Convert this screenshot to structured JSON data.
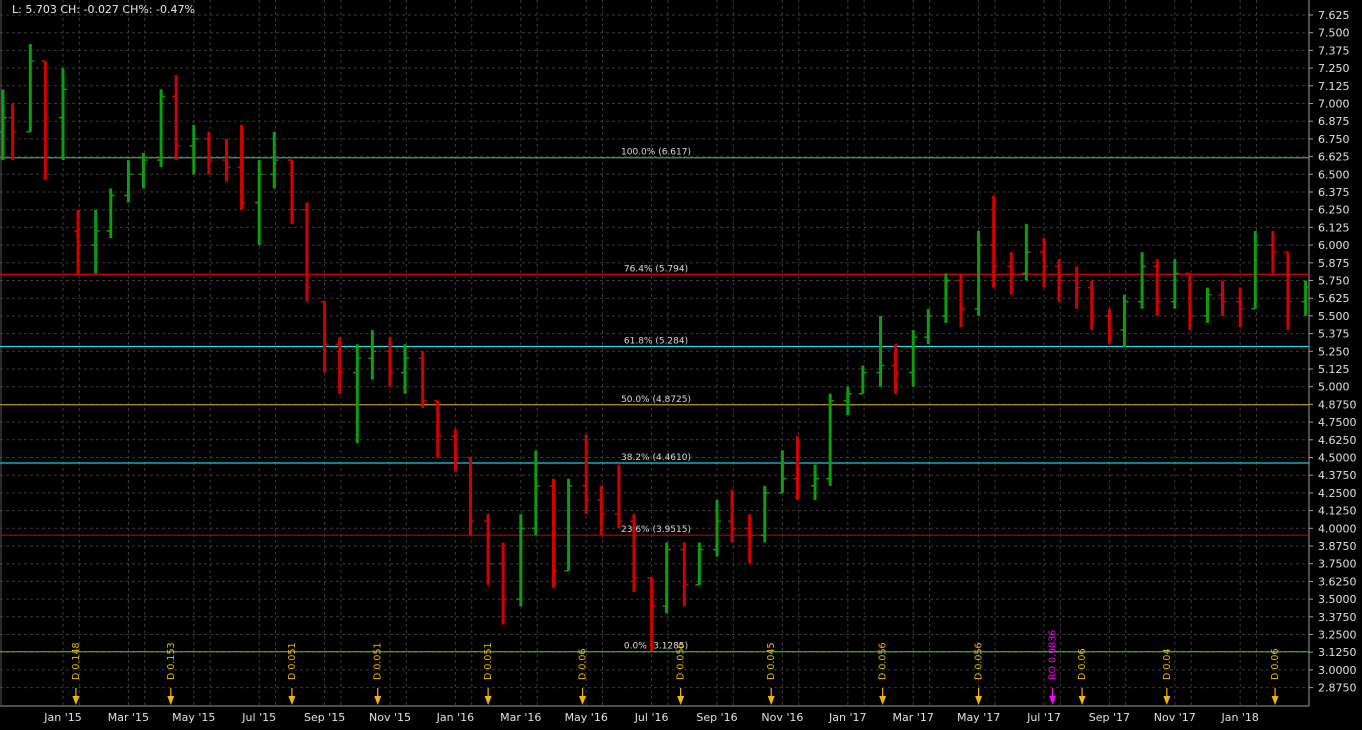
{
  "header": {
    "readout": "L: 5.703 CH: -0.027 CH%: -0.47%"
  },
  "colors": {
    "up": "#0c9e0c",
    "down": "#d40000",
    "background": "#000000",
    "grid": "#3a3a3a",
    "axis": "#9a9a9a",
    "dividend": "#f0b800",
    "rights": "#ff00ff"
  },
  "chart_data": {
    "type": "ohlc",
    "ylim": [
      2.8,
      7.68
    ],
    "y_ticks": [
      "7.625",
      "7.500",
      "7.375",
      "7.250",
      "7.125",
      "7.000",
      "6.875",
      "6.750",
      "6.625",
      "6.500",
      "6.375",
      "6.250",
      "6.125",
      "6.000",
      "5.875",
      "5.750",
      "5.625",
      "5.500",
      "5.375",
      "5.250",
      "5.125",
      "5.000",
      "4.8750",
      "4.7500",
      "4.6250",
      "4.5000",
      "4.3750",
      "4.2500",
      "4.1250",
      "4.0000",
      "3.8750",
      "3.7500",
      "3.6250",
      "3.5000",
      "3.3750",
      "3.2500",
      "3.1250",
      "3.0000",
      "2.8750"
    ],
    "x_ticks": [
      {
        "label": "Jan '15",
        "date": "2015-01-01"
      },
      {
        "label": "Mar '15",
        "date": "2015-03-01"
      },
      {
        "label": "May '15",
        "date": "2015-05-01"
      },
      {
        "label": "Jul '15",
        "date": "2015-07-01"
      },
      {
        "label": "Sep '15",
        "date": "2015-09-01"
      },
      {
        "label": "Nov '15",
        "date": "2015-11-01"
      },
      {
        "label": "Jan '16",
        "date": "2016-01-01"
      },
      {
        "label": "Mar '16",
        "date": "2016-03-01"
      },
      {
        "label": "May '16",
        "date": "2016-05-01"
      },
      {
        "label": "Jul '16",
        "date": "2016-07-01"
      },
      {
        "label": "Sep '16",
        "date": "2016-09-01"
      },
      {
        "label": "Nov '16",
        "date": "2016-11-01"
      },
      {
        "label": "Jan '17",
        "date": "2017-01-01"
      },
      {
        "label": "Mar '17",
        "date": "2017-03-01"
      },
      {
        "label": "May '17",
        "date": "2017-05-01"
      },
      {
        "label": "Jul '17",
        "date": "2017-07-01"
      },
      {
        "label": "Sep '17",
        "date": "2017-09-01"
      },
      {
        "label": "Nov '17",
        "date": "2017-11-01"
      },
      {
        "label": "Jan '18",
        "date": "2018-01-01"
      }
    ],
    "grid": true,
    "bars": [
      [
        "2014-11-05",
        6.8,
        7.1,
        6.6,
        6.9
      ],
      [
        "2014-11-15",
        6.9,
        7.0,
        6.6,
        6.8
      ],
      [
        "2014-12-01",
        6.8,
        7.42,
        6.8,
        7.3
      ],
      [
        "2014-12-15",
        7.3,
        7.3,
        6.46,
        6.9
      ],
      [
        "2015-01-01",
        6.9,
        7.25,
        6.6,
        7.1
      ],
      [
        "2015-01-15",
        6.1,
        6.25,
        5.79,
        6.0
      ],
      [
        "2015-02-01",
        6.0,
        6.25,
        5.8,
        6.1
      ],
      [
        "2015-02-15",
        6.1,
        6.4,
        6.05,
        6.35
      ],
      [
        "2015-03-01",
        6.35,
        6.6,
        6.3,
        6.5
      ],
      [
        "2015-03-15",
        6.5,
        6.65,
        6.4,
        6.6
      ],
      [
        "2015-04-01",
        6.6,
        7.1,
        6.55,
        7.05
      ],
      [
        "2015-04-15",
        7.05,
        7.2,
        6.6,
        6.7
      ],
      [
        "2015-05-01",
        6.7,
        6.85,
        6.5,
        6.75
      ],
      [
        "2015-05-15",
        6.75,
        6.8,
        6.5,
        6.6
      ],
      [
        "2015-06-01",
        6.6,
        6.75,
        6.45,
        6.55
      ],
      [
        "2015-06-15",
        6.55,
        6.85,
        6.25,
        6.3
      ],
      [
        "2015-07-01",
        6.3,
        6.6,
        6.0,
        6.5
      ],
      [
        "2015-07-15",
        6.5,
        6.8,
        6.4,
        6.6
      ],
      [
        "2015-08-01",
        6.6,
        6.6,
        6.15,
        6.25
      ],
      [
        "2015-08-15",
        6.25,
        6.3,
        5.6,
        5.7
      ],
      [
        "2015-09-01",
        5.6,
        5.6,
        5.1,
        5.3
      ],
      [
        "2015-09-15",
        5.3,
        5.35,
        4.95,
        5.1
      ],
      [
        "2015-10-01",
        5.1,
        5.3,
        4.6,
        5.2
      ],
      [
        "2015-10-15",
        5.2,
        5.4,
        5.05,
        5.25
      ],
      [
        "2015-11-01",
        5.25,
        5.35,
        5.0,
        5.1
      ],
      [
        "2015-11-15",
        5.1,
        5.3,
        4.95,
        5.2
      ],
      [
        "2015-12-01",
        5.2,
        5.25,
        4.85,
        4.9
      ],
      [
        "2015-12-15",
        4.9,
        4.9,
        4.5,
        4.65
      ],
      [
        "2016-01-01",
        4.65,
        4.7,
        4.4,
        4.5
      ],
      [
        "2016-01-15",
        4.5,
        4.5,
        3.95,
        4.05
      ],
      [
        "2016-02-01",
        4.05,
        4.1,
        3.6,
        3.75
      ],
      [
        "2016-02-15",
        3.75,
        3.9,
        3.32,
        3.5
      ],
      [
        "2016-03-01",
        3.5,
        4.1,
        3.45,
        4.0
      ],
      [
        "2016-03-15",
        4.0,
        4.55,
        3.95,
        4.3
      ],
      [
        "2016-04-01",
        4.3,
        4.35,
        3.58,
        3.7
      ],
      [
        "2016-04-15",
        3.7,
        4.35,
        3.7,
        4.3
      ],
      [
        "2016-05-01",
        4.3,
        4.66,
        4.1,
        4.2
      ],
      [
        "2016-05-15",
        4.2,
        4.3,
        3.95,
        4.1
      ],
      [
        "2016-06-01",
        4.1,
        4.45,
        4.0,
        4.05
      ],
      [
        "2016-06-15",
        4.05,
        4.1,
        3.55,
        3.65
      ],
      [
        "2016-07-01",
        3.65,
        3.65,
        3.13,
        3.45
      ],
      [
        "2016-07-15",
        3.45,
        3.9,
        3.4,
        3.85
      ],
      [
        "2016-08-01",
        3.85,
        3.9,
        3.45,
        3.6
      ],
      [
        "2016-08-15",
        3.6,
        3.9,
        3.6,
        3.85
      ],
      [
        "2016-09-01",
        3.85,
        4.2,
        3.8,
        4.05
      ],
      [
        "2016-09-15",
        4.05,
        4.27,
        3.9,
        4.0
      ],
      [
        "2016-10-01",
        4.0,
        4.1,
        3.75,
        3.95
      ],
      [
        "2016-10-15",
        3.95,
        4.3,
        3.9,
        4.25
      ],
      [
        "2016-11-01",
        4.25,
        4.55,
        4.25,
        4.35
      ],
      [
        "2016-11-15",
        4.35,
        4.65,
        4.2,
        4.3
      ],
      [
        "2016-12-01",
        4.3,
        4.45,
        4.2,
        4.35
      ],
      [
        "2016-12-15",
        4.35,
        4.95,
        4.3,
        4.9
      ],
      [
        "2017-01-01",
        4.9,
        5.0,
        4.8,
        4.95
      ],
      [
        "2017-01-15",
        4.95,
        5.15,
        4.95,
        5.1
      ],
      [
        "2017-02-01",
        5.1,
        5.5,
        5.0,
        5.15
      ],
      [
        "2017-02-15",
        5.15,
        5.3,
        4.95,
        5.1
      ],
      [
        "2017-03-01",
        5.1,
        5.4,
        5.0,
        5.35
      ],
      [
        "2017-03-15",
        5.35,
        5.55,
        5.3,
        5.5
      ],
      [
        "2017-04-01",
        5.5,
        5.8,
        5.45,
        5.75
      ],
      [
        "2017-04-15",
        5.75,
        5.8,
        5.42,
        5.55
      ],
      [
        "2017-05-01",
        5.55,
        6.1,
        5.5,
        6.0
      ],
      [
        "2017-05-15",
        6.0,
        6.35,
        5.7,
        5.85
      ],
      [
        "2017-06-01",
        5.85,
        5.95,
        5.65,
        5.8
      ],
      [
        "2017-06-15",
        5.8,
        6.15,
        5.75,
        5.95
      ],
      [
        "2017-07-01",
        5.95,
        6.05,
        5.7,
        5.85
      ],
      [
        "2017-07-15",
        5.85,
        5.9,
        5.6,
        5.75
      ],
      [
        "2017-08-01",
        5.75,
        5.85,
        5.55,
        5.7
      ],
      [
        "2017-08-15",
        5.7,
        5.75,
        5.4,
        5.5
      ],
      [
        "2017-09-01",
        5.5,
        5.55,
        5.3,
        5.4
      ],
      [
        "2017-09-15",
        5.4,
        5.65,
        5.28,
        5.6
      ],
      [
        "2017-10-01",
        5.6,
        5.95,
        5.55,
        5.85
      ],
      [
        "2017-10-15",
        5.85,
        5.9,
        5.5,
        5.6
      ],
      [
        "2017-11-01",
        5.6,
        5.9,
        5.55,
        5.8
      ],
      [
        "2017-11-15",
        5.8,
        5.8,
        5.4,
        5.5
      ],
      [
        "2017-12-01",
        5.5,
        5.7,
        5.45,
        5.65
      ],
      [
        "2017-12-15",
        5.65,
        5.75,
        5.5,
        5.6
      ],
      [
        "2018-01-01",
        5.6,
        5.7,
        5.42,
        5.55
      ],
      [
        "2018-01-15",
        5.55,
        6.1,
        5.55,
        6.0
      ],
      [
        "2018-02-01",
        6.0,
        6.1,
        5.8,
        5.95
      ],
      [
        "2018-02-15",
        5.95,
        5.95,
        5.4,
        5.6
      ],
      [
        "2018-03-01",
        5.6,
        5.75,
        5.5,
        5.703
      ]
    ],
    "fib_levels": [
      {
        "label": "100.0% (6.617)",
        "value": 6.617,
        "color": "#5f8f5f"
      },
      {
        "label": "76.4% (5.794)",
        "value": 5.794,
        "color": "#e00000"
      },
      {
        "label": "61.8% (5.284)",
        "value": 5.284,
        "color": "#20e0f0"
      },
      {
        "label": "50.0% (4.8725)",
        "value": 4.8725,
        "color": "#b8902a"
      },
      {
        "label": "38.2% (4.4610)",
        "value": 4.461,
        "color": "#20c8e0"
      },
      {
        "label": "23.6% (3.9515)",
        "value": 3.9515,
        "color": "#c00000"
      },
      {
        "label": "0.0% (3.1285)",
        "value": 3.1285,
        "color": "#10d010"
      }
    ],
    "events": [
      {
        "label": "D 0.148",
        "date": "2015-01-13",
        "kind": "dividend"
      },
      {
        "label": "D 0.153",
        "date": "2015-04-10",
        "kind": "dividend"
      },
      {
        "label": "D 0.051",
        "date": "2015-08-01",
        "kind": "dividend"
      },
      {
        "label": "D 0.051",
        "date": "2015-10-20",
        "kind": "dividend"
      },
      {
        "label": "D 0.051",
        "date": "2016-02-01",
        "kind": "dividend"
      },
      {
        "label": "D 0.06",
        "date": "2016-04-28",
        "kind": "dividend"
      },
      {
        "label": "D 0.056",
        "date": "2016-07-28",
        "kind": "dividend"
      },
      {
        "label": "D 0.045",
        "date": "2016-10-21",
        "kind": "dividend"
      },
      {
        "label": "D 0.056",
        "date": "2017-02-03",
        "kind": "dividend"
      },
      {
        "label": "D 0.056",
        "date": "2017-05-01",
        "kind": "dividend"
      },
      {
        "label": "RO 0.9836",
        "date": "2017-07-09",
        "kind": "rights"
      },
      {
        "label": "D 0.06",
        "date": "2017-08-06",
        "kind": "dividend"
      },
      {
        "label": "D 0.04",
        "date": "2017-10-24",
        "kind": "dividend"
      },
      {
        "label": "D 0.06",
        "date": "2018-02-03",
        "kind": "dividend"
      }
    ]
  }
}
